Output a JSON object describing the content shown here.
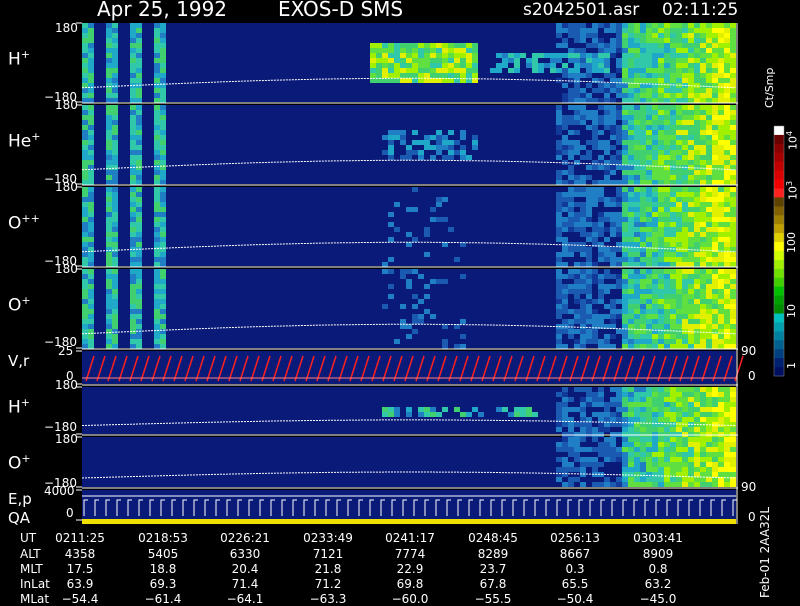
{
  "header": {
    "date": "Apr 25, 1992",
    "instrument": "EXOS-D SMS",
    "file": "s2042501.asr",
    "time": "02:11:25"
  },
  "panels": [
    {
      "key": "h_plus",
      "label": "H",
      "sup": "+",
      "ymax": "180",
      "ymin": "−180"
    },
    {
      "key": "he_plus",
      "label": "He",
      "sup": "+",
      "ymax": "180",
      "ymin": "−180"
    },
    {
      "key": "o_pp",
      "label": "O",
      "sup": "++",
      "ymax": "180",
      "ymin": "−180"
    },
    {
      "key": "o_plus",
      "label": "O",
      "sup": "+",
      "ymax": "180",
      "ymin": "−180"
    },
    {
      "key": "vr",
      "label": "V,r",
      "sup": "",
      "ymax": "25",
      "ymin": "0",
      "right": "90",
      "right_min": "0"
    },
    {
      "key": "h_plus_2",
      "label": "H",
      "sup": "+",
      "ymax": "180",
      "ymin": "−180"
    },
    {
      "key": "o_plus_2",
      "label": "O",
      "sup": "+",
      "ymax": "180",
      "ymin": "−180",
      "right": "90"
    },
    {
      "key": "ep",
      "label": "E,p",
      "sup": "",
      "ymax": "4000",
      "ymin": "0",
      "right_min": "0"
    }
  ],
  "qa_label": "QA",
  "colorbar": {
    "unit": "Ct/Smp",
    "ticks": [
      "10",
      "10",
      "100",
      "10",
      "1"
    ],
    "tick_sup": [
      "4",
      "3",
      "",
      "",
      ""
    ],
    "colors": [
      "#ffffff",
      "#6b0000",
      "#8b0000",
      "#a50000",
      "#c00000",
      "#d80000",
      "#f00000",
      "#ff2020",
      "#5c4300",
      "#806000",
      "#a08000",
      "#c0a000",
      "#e0d000",
      "#ffff00",
      "#d0ff00",
      "#a0f000",
      "#70e000",
      "#40d000",
      "#00c000",
      "#00a000",
      "#008a00",
      "#00c0c0",
      "#00a0b0",
      "#0080a0",
      "#006090",
      "#004080",
      "#002070",
      "#001060"
    ]
  },
  "footer_id": "Feb-01 2AA32L",
  "table": {
    "labels": [
      "UT",
      "ALT",
      "MLT",
      "InLat",
      "MLat"
    ],
    "columns": [
      [
        "0211:25",
        "4358",
        "17.5",
        "63.9",
        "−54.4"
      ],
      [
        "0218:53",
        "5405",
        "18.8",
        "69.3",
        "−61.4"
      ],
      [
        "0226:21",
        "6330",
        "20.4",
        "71.4",
        "−64.1"
      ],
      [
        "0233:49",
        "7121",
        "21.8",
        "71.2",
        "−63.3"
      ],
      [
        "0241:17",
        "7774",
        "22.9",
        "69.8",
        "−60.0"
      ],
      [
        "0248:45",
        "8289",
        "23.7",
        "67.8",
        "−55.5"
      ],
      [
        "0256:13",
        "8667",
        "0.3",
        "65.5",
        "−50.4"
      ],
      [
        "0303:41",
        "8909",
        "0.8",
        "63.2",
        "−45.0"
      ]
    ]
  },
  "chart_data": {
    "type": "heatmap",
    "title": "Apr 25, 1992 EXOS-D SMS",
    "x_label": "UT",
    "x_ticks": [
      "0211:25",
      "0218:53",
      "0226:21",
      "0233:49",
      "0241:17",
      "0248:45",
      "0256:13",
      "0303:41"
    ],
    "y_range": [
      -180,
      180
    ],
    "color_scale": "log",
    "color_range": [
      1,
      10000
    ],
    "color_unit": "Ct/Smp",
    "series": [
      {
        "name": "H+",
        "ylim": [
          -180,
          180
        ]
      },
      {
        "name": "He+",
        "ylim": [
          -180,
          180
        ]
      },
      {
        "name": "O++",
        "ylim": [
          -180,
          180
        ]
      },
      {
        "name": "O+",
        "ylim": [
          -180,
          180
        ]
      },
      {
        "name": "V,r",
        "ylim": [
          0,
          25
        ]
      },
      {
        "name": "H+",
        "ylim": [
          -180,
          180
        ]
      },
      {
        "name": "O+",
        "ylim": [
          -180,
          180
        ]
      },
      {
        "name": "E,p",
        "ylim": [
          0,
          4000
        ]
      }
    ]
  }
}
